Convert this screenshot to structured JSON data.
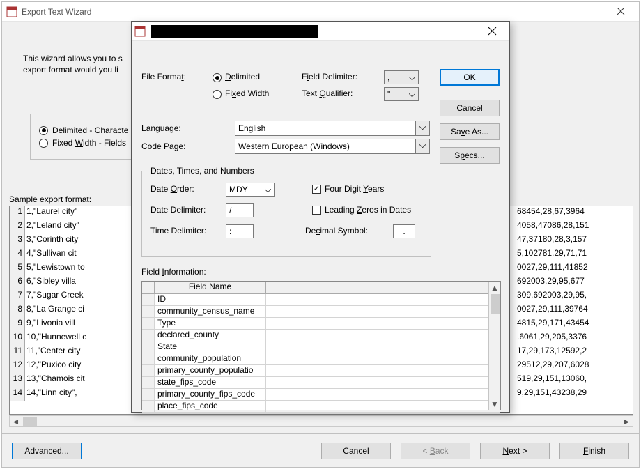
{
  "outer": {
    "title": "Export Text Wizard",
    "wizard_text_line1": "This wizard allows you to s",
    "wizard_text_line2": "export format would you li",
    "radio_delimited": "Delimited - Characte",
    "radio_fixed": "Fixed Width - Fields",
    "sample_label": "Sample export format:",
    "advanced_btn": "Advanced...",
    "cancel_btn": "Cancel",
    "back_btn": "< Back",
    "next_btn": "Next >",
    "finish_btn": "Finish"
  },
  "sample_rows": [
    {
      "n": "1",
      "left": "1,\"Laurel city\"",
      "right": "68454,28,67,3964"
    },
    {
      "n": "2",
      "left": "2,\"Leland city\"",
      "right": "4058,47086,28,151"
    },
    {
      "n": "3",
      "left": "3,\"Corinth city",
      "right": "47,37180,28,3,157"
    },
    {
      "n": "4",
      "left": "4,\"Sullivan cit",
      "right": "5,102781,29,71,71"
    },
    {
      "n": "5",
      "left": "5,\"Lewistown to",
      "right": "0027,29,111,41852"
    },
    {
      "n": "6",
      "left": "6,\"Sibley villa",
      "right": "692003,29,95,677"
    },
    {
      "n": "7",
      "left": "7,\"Sugar Creek ",
      "right": "309,692003,29,95,"
    },
    {
      "n": "8",
      "left": "8,\"La Grange ci",
      "right": "0027,29,111,39764"
    },
    {
      "n": "9",
      "left": "9,\"Livonia vill",
      "right": "4815,29,171,43454"
    },
    {
      "n": "10",
      "left": "10,\"Hunnewell c",
      "right": ".6061,29,205,3376"
    },
    {
      "n": "11",
      "left": "11,\"Center city",
      "right": "17,29,173,12592,2"
    },
    {
      "n": "12",
      "left": "12,\"Puxico city",
      "right": "29512,29,207,6028"
    },
    {
      "n": "13",
      "left": "13,\"Chamois cit",
      "right": "519,29,151,13060,"
    },
    {
      "n": "14",
      "left": "14,\"Linn city\",",
      "right": "9,29,151,43238,29"
    }
  ],
  "inner": {
    "file_format_label": "File Format:",
    "delimited": "Delimited",
    "fixed_width": "Fixed Width",
    "field_delimiter_label": "Field Delimiter:",
    "field_delimiter_value": ",",
    "text_qualifier_label": "Text Qualifier:",
    "text_qualifier_value": "\"",
    "language_label": "Language:",
    "language_value": "English",
    "codepage_label": "Code Page:",
    "codepage_value": "Western European (Windows)",
    "group_title": "Dates, Times, and Numbers",
    "date_order_label": "Date Order:",
    "date_order_value": "MDY",
    "four_digit_years": "Four Digit Years",
    "date_delimiter_label": "Date Delimiter:",
    "date_delimiter_value": "/",
    "leading_zeros": "Leading Zeros in Dates",
    "time_delimiter_label": "Time Delimiter:",
    "time_delimiter_value": ":",
    "decimal_symbol_label": "Decimal Symbol:",
    "decimal_symbol_value": ".",
    "field_info_label": "Field Information:",
    "field_name_header": "Field Name",
    "ok_btn": "OK",
    "cancel_btn": "Cancel",
    "saveas_btn": "Save As...",
    "specs_btn": "Specs..."
  },
  "field_rows": [
    "ID",
    "community_census_name",
    "Type",
    "declared_county",
    "State",
    "community_population",
    "primary_county_populatio",
    "state_fips_code",
    "primary_county_fips_code",
    "place_fips_code"
  ]
}
